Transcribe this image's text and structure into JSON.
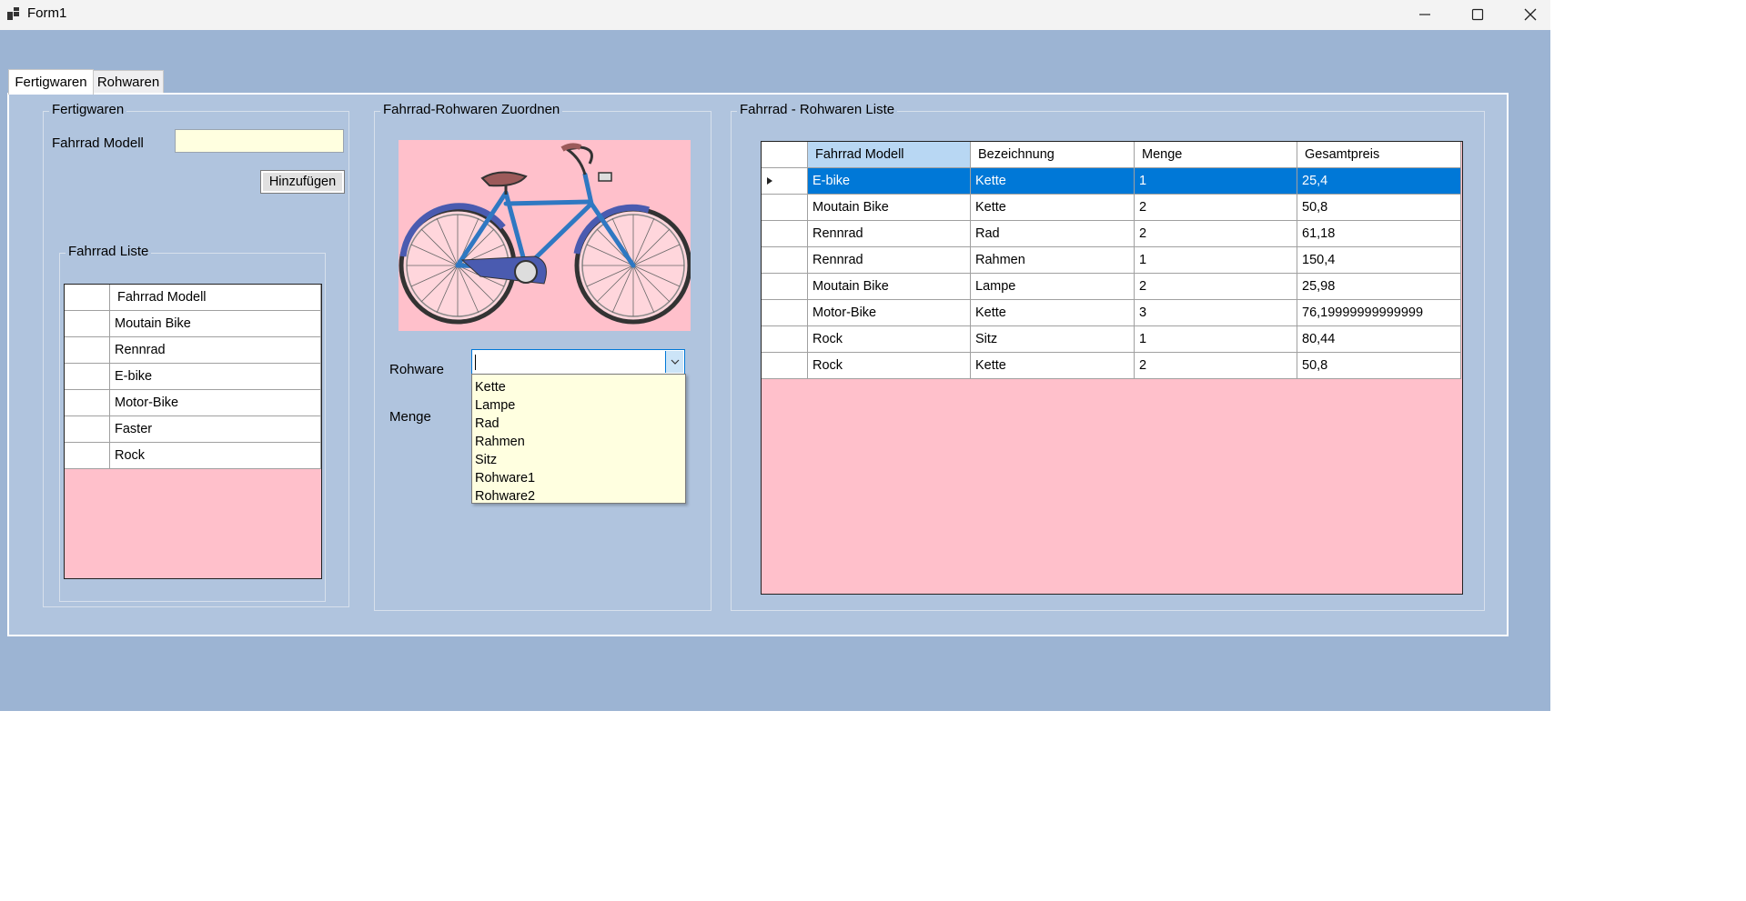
{
  "window": {
    "title": "Form1"
  },
  "tabs": [
    {
      "label": "Fertigwaren"
    },
    {
      "label": "Rohwaren"
    }
  ],
  "fertigwaren_group": {
    "title": "Fertigwaren",
    "model_label": "Fahrrad Modell",
    "model_value": "",
    "add_button": "Hinzufügen"
  },
  "fahrrad_liste": {
    "title": "Fahrrad Liste",
    "header": "Fahrrad Modell",
    "rows": [
      "Moutain Bike",
      "Rennrad",
      "E-bike",
      "Motor-Bike",
      "Faster",
      "Rock"
    ]
  },
  "zuordnen_group": {
    "title": "Fahrrad-Rohwaren Zuordnen",
    "rohware_label": "Rohware",
    "menge_label": "Menge",
    "rohware_value": "",
    "dropdown_options": [
      "Kette",
      "Lampe",
      "Rad",
      "Rahmen",
      "Sitz",
      "Rohware1",
      "Rohware2"
    ]
  },
  "rohwaren_liste": {
    "title": "Fahrrad - Rohwaren Liste",
    "columns": [
      "Fahrrad Modell",
      "Bezeichnung",
      "Menge",
      "Gesamtpreis"
    ],
    "rows": [
      [
        "E-bike",
        "Kette",
        "1",
        "25,4"
      ],
      [
        "Moutain Bike",
        "Kette",
        "2",
        "50,8"
      ],
      [
        "Rennrad",
        "Rad",
        "2",
        "61,18"
      ],
      [
        "Rennrad",
        "Rahmen",
        "1",
        "150,4"
      ],
      [
        "Moutain Bike",
        "Lampe",
        "2",
        "25,98"
      ],
      [
        "Motor-Bike",
        "Kette",
        "3",
        "76,19999999999999"
      ],
      [
        "Rock",
        "Sitz",
        "1",
        "80,44"
      ],
      [
        "Rock",
        "Kette",
        "2",
        "50,8"
      ]
    ],
    "selected_row": 0
  },
  "colors": {
    "form_bg": "#9cb4d3",
    "panel_bg": "#b0c4de",
    "grid_bg": "#ffc0cb",
    "input_bg": "#ffffe0",
    "selection": "#0078d7"
  },
  "icons": {
    "minimize": "minimize-icon",
    "maximize": "maximize-icon",
    "close": "close-icon",
    "dropdown": "chevron-down-icon",
    "row_indicator": "row-arrow-icon"
  }
}
